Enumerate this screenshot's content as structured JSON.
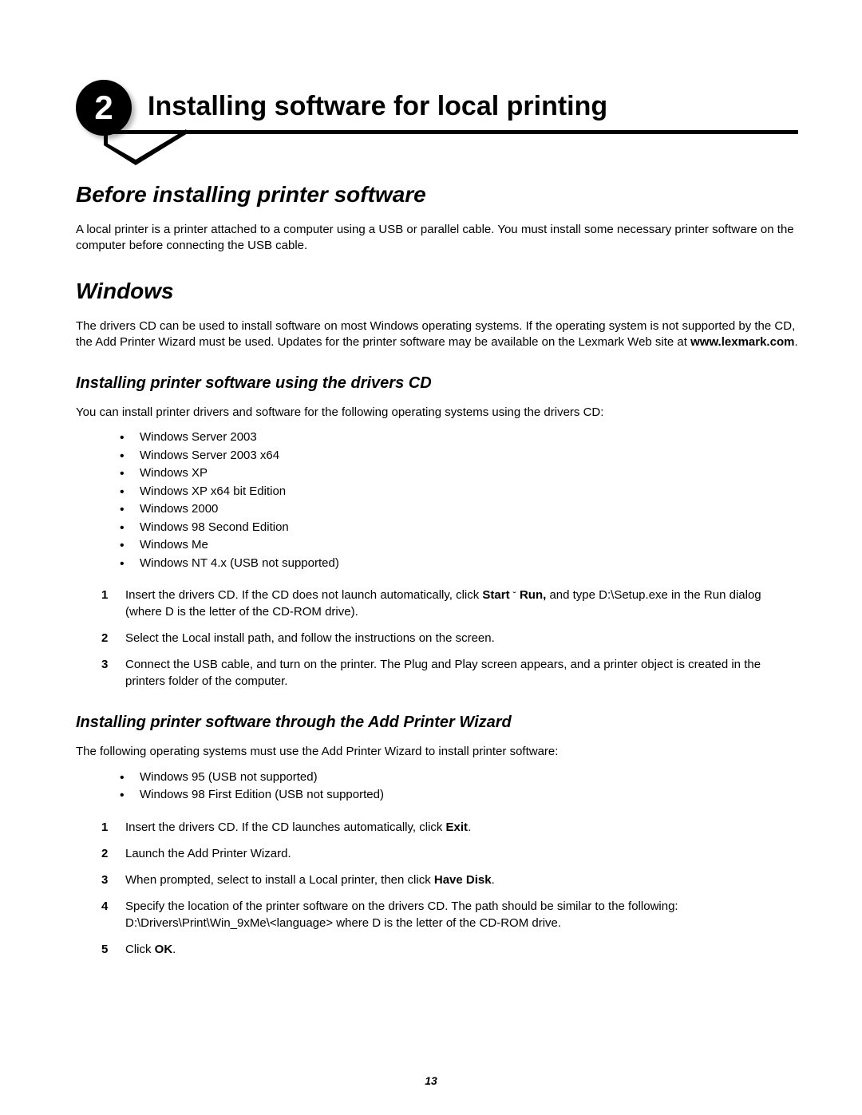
{
  "chapter": {
    "number": "2",
    "title": "Installing software for local printing"
  },
  "section1": {
    "heading": "Before installing printer software",
    "para": "A local printer is a printer attached to a computer using a USB or parallel cable. You must install some necessary printer software on the computer before connecting the USB cable."
  },
  "section2": {
    "heading": "Windows",
    "para_pre": "The drivers CD can be used to install software on most Windows operating systems. If the operating system is not supported by the CD, the Add Printer Wizard must be used. Updates for the printer software may be available on the Lexmark Web site at ",
    "para_bold": "www.lexmark.com",
    "para_post": "."
  },
  "sub1": {
    "heading": "Installing printer software using the drivers CD",
    "intro": "You can install printer drivers and software for the following operating systems using the drivers CD:",
    "bullets": [
      "Windows Server 2003",
      "Windows Server 2003 x64",
      "Windows XP",
      "Windows XP x64 bit Edition",
      "Windows 2000",
      "Windows 98 Second Edition",
      "Windows Me",
      "Windows NT 4.x (USB not supported)"
    ],
    "steps": [
      {
        "n": "1",
        "pre": "Insert the drivers CD. If the CD does not launch automatically, click ",
        "b1": "Start",
        "mid": "  ",
        "arrow": "˘",
        "mid2": "  ",
        "b2": "Run,",
        "post": " and type D:\\Setup.exe      in the Run dialog (where D is the letter of the CD-ROM drive)."
      },
      {
        "n": "2",
        "text": "Select the Local install path, and follow the instructions on the screen."
      },
      {
        "n": "3",
        "text": "Connect the USB cable, and turn on the printer. The Plug and Play screen appears, and a printer object is created in the printers folder of the computer."
      }
    ]
  },
  "sub2": {
    "heading": "Installing printer software through the Add Printer Wizard",
    "intro": "The following operating systems must use the Add Printer Wizard to install printer software:",
    "bullets": [
      "Windows 95 (USB not supported)",
      "Windows 98 First Edition (USB not supported)"
    ],
    "steps": [
      {
        "n": "1",
        "pre": "Insert the drivers CD. If the CD launches automatically, click ",
        "b1": "Exit",
        "post": "."
      },
      {
        "n": "2",
        "text": "Launch the Add Printer Wizard."
      },
      {
        "n": "3",
        "pre": "When prompted, select to install a Local printer, then click ",
        "b1": "Have Disk",
        "post": "."
      },
      {
        "n": "4",
        "text": "Specify the location of the printer software on the drivers CD. The path should be similar to the following: D:\\Drivers\\Print\\Win_9xMe\\<language>                where D is the letter of the CD-ROM drive."
      },
      {
        "n": "5",
        "pre": "Click ",
        "b1": "OK",
        "post": "."
      }
    ]
  },
  "page_number": "13"
}
